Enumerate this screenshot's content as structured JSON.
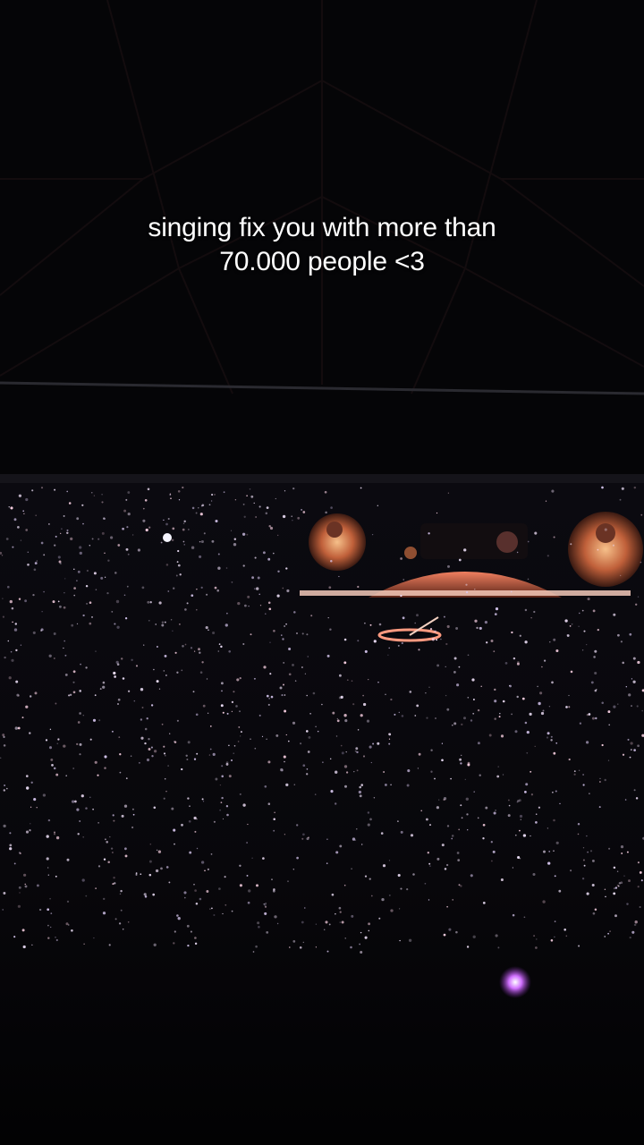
{
  "caption": {
    "line1": "singing fix you with more than",
    "line2": "70.000 people <3"
  },
  "colors": {
    "background": "#050507",
    "stage_glow": "#e06a4a",
    "screen_glow": "#f0a070",
    "phone_lights": "#e8d8f0",
    "light_stick": "#d070ff"
  }
}
